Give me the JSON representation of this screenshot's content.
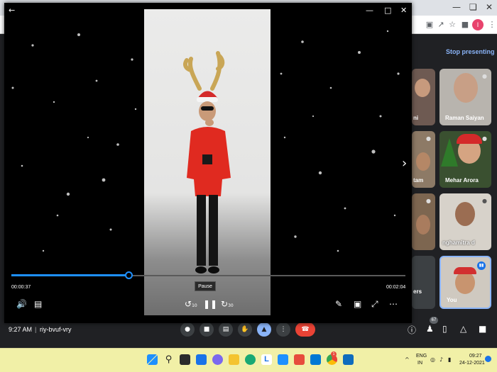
{
  "player": {
    "current_time": "00:00:37",
    "total_time": "00:02:04",
    "progress_fraction": 0.298,
    "tooltip": "Pause",
    "skip_back_label": "10",
    "skip_forward_label": "30",
    "icons": {
      "back": "back-arrow-icon",
      "minimize": "minimize-icon",
      "maximize": "maximize-icon",
      "close": "close-icon",
      "volume": "volume-icon",
      "captions": "captions-icon",
      "pause": "pause-icon",
      "edit": "pen-icon",
      "miniplayer": "miniplayer-icon",
      "fullscreen": "fullscreen-icon",
      "more": "more-icon",
      "next": "chevron-right-icon"
    }
  },
  "meet": {
    "stop_presenting": "Stop presenting",
    "tiles": [
      {
        "name": "ni"
      },
      {
        "name": "Raman Saiyan"
      },
      {
        "name": "tam"
      },
      {
        "name": "Mehar Arora"
      },
      {
        "name": ""
      },
      {
        "name": "nghamitra d"
      },
      {
        "name": "ers"
      },
      {
        "name": "You"
      }
    ],
    "time": "9:27 AM",
    "separator": "|",
    "meeting_code": "riy-bvuf-vry",
    "participant_count": "67",
    "colors": {
      "accent": "#8ab4f8",
      "end_call": "#ea4335"
    }
  },
  "taskbar": {
    "lang_line1": "ENG",
    "lang_line2": "IN",
    "clock_time": "09:27",
    "clock_date": "24-12-2021",
    "notification_count": "1",
    "colors": {
      "background": "#f1f0a7"
    }
  },
  "browser": {
    "profile_initial": "I"
  }
}
